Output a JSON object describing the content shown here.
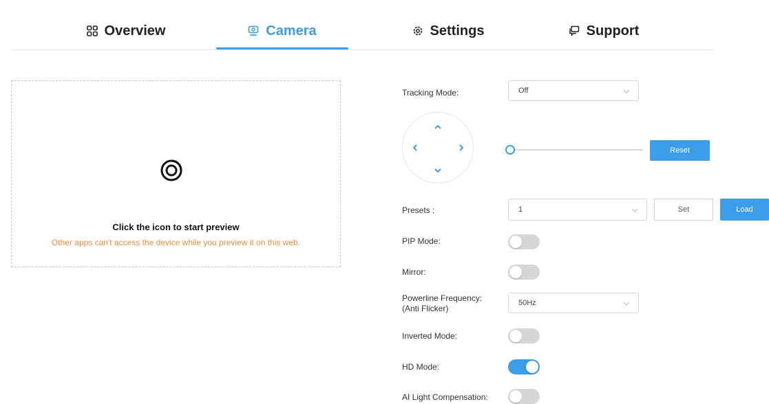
{
  "tabs": [
    {
      "label": "Overview",
      "icon": "grid-icon",
      "active": false
    },
    {
      "label": "Camera",
      "icon": "camera-icon",
      "active": true
    },
    {
      "label": "Settings",
      "icon": "gear-icon",
      "active": false
    },
    {
      "label": "Support",
      "icon": "chat-icon",
      "active": false
    }
  ],
  "preview": {
    "title": "Click the icon to start preview",
    "warning": "Other apps can't access the device while you preview it on this web."
  },
  "controls": {
    "tracking_mode": {
      "label": "Tracking Mode:",
      "value": "Off"
    },
    "zoom": {
      "value": 0
    },
    "reset_label": "Reset",
    "presets": {
      "label": "Presets :",
      "value": "1",
      "set_label": "Set",
      "load_label": "Load"
    },
    "pip_mode": {
      "label": "PIP Mode:",
      "on": false
    },
    "mirror": {
      "label": "Mirror:",
      "on": false
    },
    "powerline": {
      "label_line1": "Powerline Frequency:",
      "label_line2": "(Anti Flicker)",
      "value": "50Hz"
    },
    "inverted_mode": {
      "label": "Inverted Mode:",
      "on": false
    },
    "hd_mode": {
      "label": "HD Mode:",
      "on": true
    },
    "ai_light": {
      "label": "AI Light Compensation:",
      "on": false
    }
  },
  "colors": {
    "accent": "#3c9de9",
    "warning": "#f08a3c"
  }
}
